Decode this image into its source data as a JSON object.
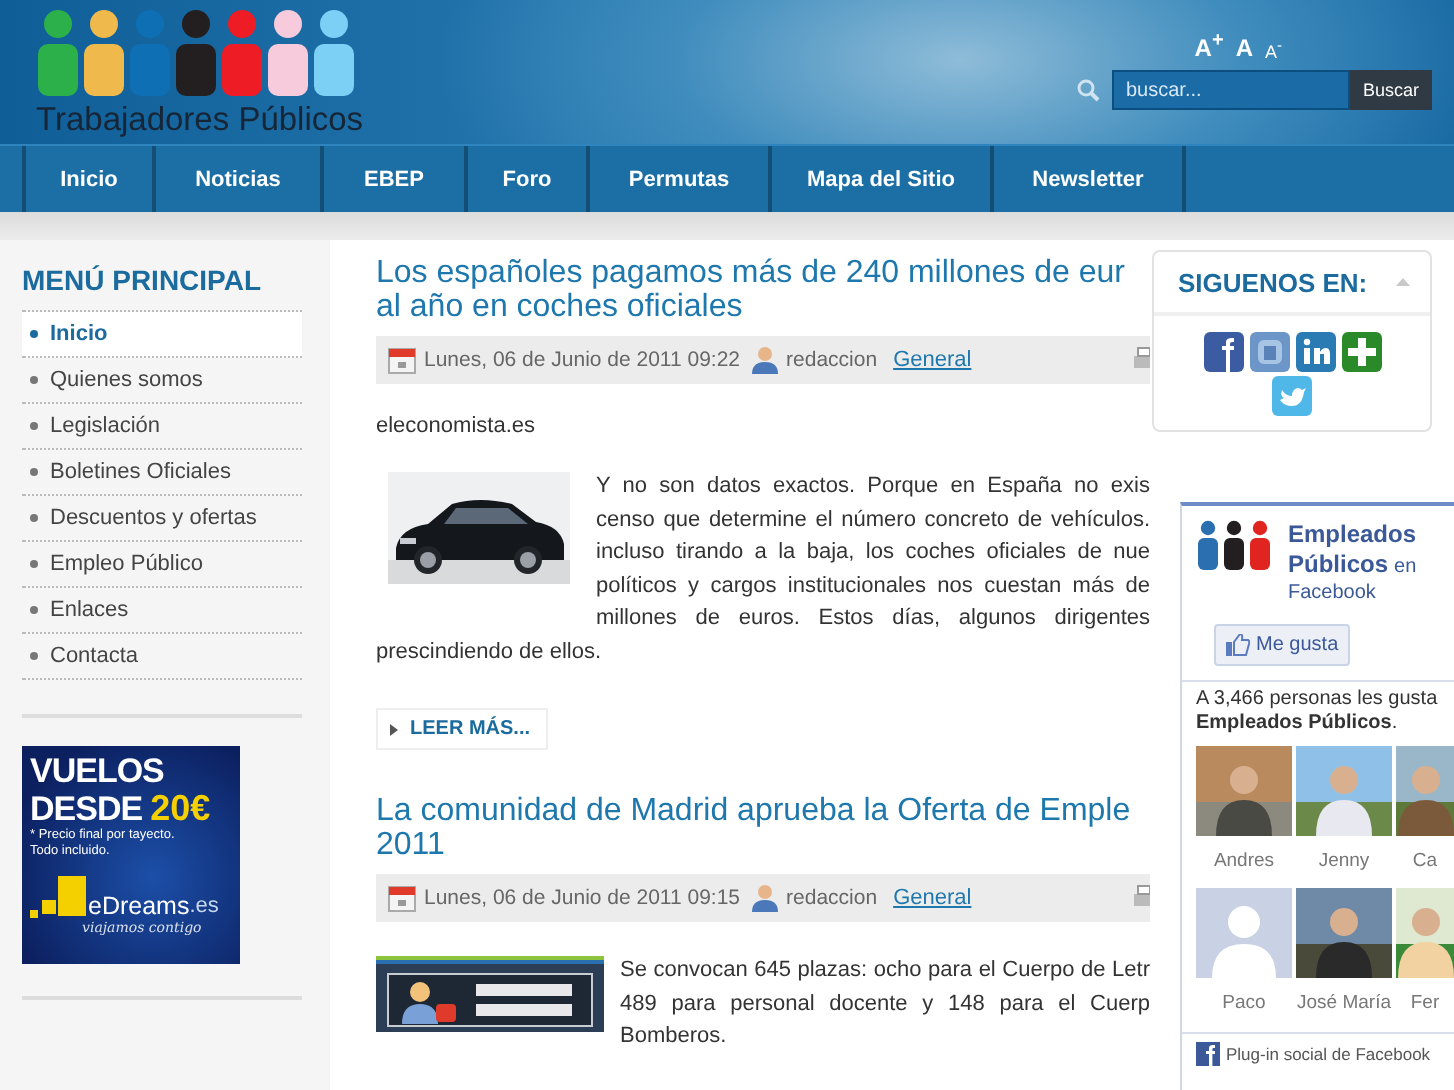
{
  "header": {
    "site_title": "Trabajadores Públicos",
    "font_size_controls": [
      "A$^{+}$",
      "A",
      "A$^{-}$"
    ],
    "search": {
      "placeholder": "buscar...",
      "button": "Buscar"
    }
  },
  "nav": [
    "Inicio",
    "Noticias",
    "EBEP",
    "Foro",
    "Permutas",
    "Mapa del Sitio",
    "Newsletter"
  ],
  "sidebar": {
    "title": "MENÚ PRINCIPAL",
    "items": [
      {
        "label": "Inicio",
        "selected": true
      },
      {
        "label": "Quienes somos",
        "selected": false
      },
      {
        "label": "Legislación",
        "selected": false
      },
      {
        "label": "Boletines Oficiales",
        "selected": false
      },
      {
        "label": "Descuentos y ofertas",
        "selected": false
      },
      {
        "label": "Empleo Público",
        "selected": false
      },
      {
        "label": "Enlaces",
        "selected": false
      },
      {
        "label": "Contacta",
        "selected": false
      }
    ],
    "ad": {
      "line_1": "VUELOS",
      "line_2": "DESDE",
      "price": "20€",
      "note_lines": [
        "* Precio final por tayecto.",
        "Todo incluido."
      ],
      "brand": "eDreams",
      "brand_suffix": ".es",
      "tagline": "viajamos contigo"
    }
  },
  "articles": [
    {
      "title_lines": [
        "Los españoles pagamos más de 240 millones de eur",
        "al año en coches oficiales"
      ],
      "date": "Lunes, 06 de Junio de 2011 09:22",
      "author": "redaccion",
      "category": "General",
      "source": "eleconomista.es",
      "body_lines": [
        "Y no son datos exactos. Porque en España no exis",
        "censo que determine el número concreto de vehículos.",
        "incluso tirando a la baja, los coches oficiales de nue",
        "políticos y cargos institucionales nos cuestan más de",
        "millones de euros. Estos días, algunos dirigentes"
      ],
      "tail_line": "prescindiendo de ellos.",
      "read_more": "LEER MÁS..."
    },
    {
      "title_lines": [
        "La comunidad de Madrid aprueba la Oferta de Emple",
        "2011"
      ],
      "date": "Lunes, 06 de Junio de 2011 09:15",
      "author": "redaccion",
      "category": "General",
      "body_lines": [
        "Se convocan 645 plazas: ocho para el Cuerpo de Letr",
        "489 para personal docente y 148 para el Cuerp"
      ],
      "tail_line": "Bomberos."
    }
  ],
  "follow": {
    "title": "SIGUENOS EN:"
  },
  "facebook": {
    "name_lines": [
      "Empleados",
      "Públicos"
    ],
    "connector": "en",
    "platform": "Facebook",
    "like_button": "Me gusta",
    "likes_line": "A 3,466 personas les gusta",
    "likes_page": "**Empleados Públicos**.",
    "fans": [
      {
        "name": "Andres"
      },
      {
        "name": "Jenny"
      },
      {
        "name": "Ca"
      },
      {
        "name": "Paco",
        "kind": "silhouette"
      },
      {
        "name": "José María"
      },
      {
        "name": "Fer"
      }
    ],
    "footer": "Plug-in social de Facebook"
  }
}
